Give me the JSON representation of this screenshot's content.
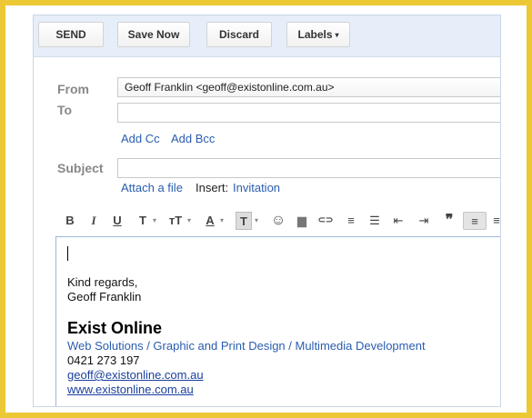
{
  "toolbar": {
    "send": "SEND",
    "save_now": "Save Now",
    "discard": "Discard",
    "labels": "Labels",
    "labels_caret": "▾"
  },
  "fields": {
    "from_label": "From",
    "from_value": "Geoff Franklin <geoff@existonline.com.au>",
    "to_label": "To",
    "to_value": "",
    "add_cc": "Add Cc",
    "add_bcc": "Add Bcc",
    "subject_label": "Subject",
    "subject_value": "",
    "attach_file": "Attach a file",
    "insert_label": "Insert:",
    "insert_invitation": "Invitation"
  },
  "format_bar": {
    "bold": "B",
    "italic": "I",
    "underline": "U",
    "font": "T",
    "size": "тT",
    "text_color": "A",
    "highlight": "T",
    "emoji": "☺",
    "image": "▆",
    "link": "⊂⊃",
    "numbered_list": "≡",
    "bulleted_list": "☰",
    "indent_less": "⇤",
    "indent_more": "⇥",
    "quote": "❞",
    "align_left": "≡",
    "align_center": "≡",
    "dropdown_caret": "▾"
  },
  "body": {
    "regards": "Kind regards,",
    "name": "Geoff Franklin",
    "company": "Exist Online",
    "services": "Web Solutions / Graphic and Print Design / Multimedia Development",
    "phone": "0421 273 197",
    "email": "geoff@existonline.com.au",
    "website": "www.existonline.com.au"
  },
  "colors": {
    "background": "#ecc835",
    "toolbar": "#e6eef9",
    "link": "#2a5db0"
  }
}
